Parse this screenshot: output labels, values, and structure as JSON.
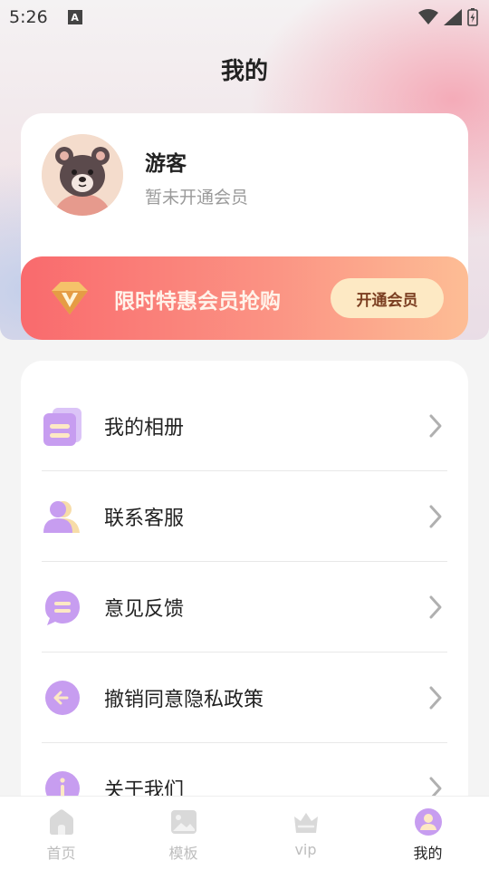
{
  "status_bar": {
    "time": "5:26",
    "notification_glyph": "A"
  },
  "header": {
    "title": "我的"
  },
  "profile": {
    "name": "游客",
    "membership_status": "暂未开通会员",
    "avatar_icon": "bear-avatar-icon"
  },
  "vip_banner": {
    "text": "限时特惠会员抢购",
    "button_label": "开通会员",
    "icon": "vip-diamond-icon"
  },
  "menu": {
    "items": [
      {
        "label": "我的相册",
        "icon": "album-icon"
      },
      {
        "label": "联系客服",
        "icon": "customer-service-icon"
      },
      {
        "label": "意见反馈",
        "icon": "feedback-icon"
      },
      {
        "label": "撤销同意隐私政策",
        "icon": "revoke-privacy-icon"
      },
      {
        "label": "关于我们",
        "icon": "about-icon"
      }
    ]
  },
  "tab_bar": {
    "tabs": [
      {
        "label": "首页",
        "icon": "home-icon",
        "active": false
      },
      {
        "label": "模板",
        "icon": "template-image-icon",
        "active": false
      },
      {
        "label": "vip",
        "icon": "crown-icon",
        "active": false
      },
      {
        "label": "我的",
        "icon": "profile-icon",
        "active": true
      }
    ]
  },
  "colors": {
    "accent_purple": "#c79df0",
    "banner_start": "#f96a6d",
    "banner_end": "#fdbd95",
    "inactive_tab": "#bdbdbd"
  }
}
